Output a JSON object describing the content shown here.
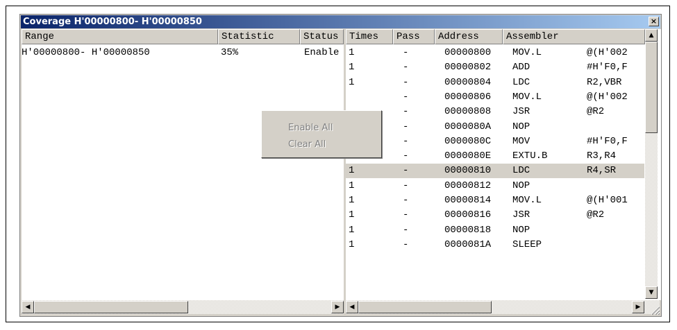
{
  "window": {
    "title": "Coverage H'00000800- H'00000850",
    "close_glyph": "×"
  },
  "left_pane": {
    "columns": [
      "Range",
      "Statistic",
      "Status"
    ],
    "rows": [
      {
        "range": "H'00000800- H'00000850",
        "statistic": "35%",
        "status": "Enable"
      }
    ]
  },
  "right_pane": {
    "columns": [
      "Times",
      "Pass",
      "Address",
      "Assembler"
    ],
    "rows": [
      {
        "times": "1",
        "pass": "-",
        "address": "00000800",
        "mnemonic": "MOV.L",
        "operand": "@(H'002"
      },
      {
        "times": "1",
        "pass": "-",
        "address": "00000802",
        "mnemonic": "ADD",
        "operand": "#H'F0,F"
      },
      {
        "times": "1",
        "pass": "-",
        "address": "00000804",
        "mnemonic": "LDC",
        "operand": "R2,VBR"
      },
      {
        "times": "",
        "pass": "-",
        "address": "00000806",
        "mnemonic": "MOV.L",
        "operand": "@(H'002"
      },
      {
        "times": "",
        "pass": "-",
        "address": "00000808",
        "mnemonic": "JSR",
        "operand": "@R2"
      },
      {
        "times": "",
        "pass": "-",
        "address": "0000080A",
        "mnemonic": "NOP",
        "operand": ""
      },
      {
        "times": "1",
        "pass": "-",
        "address": "0000080C",
        "mnemonic": "MOV",
        "operand": "#H'F0,F"
      },
      {
        "times": "1",
        "pass": "-",
        "address": "0000080E",
        "mnemonic": "EXTU.B",
        "operand": "R3,R4"
      },
      {
        "times": "1",
        "pass": "-",
        "address": "00000810",
        "mnemonic": "LDC",
        "operand": "R4,SR",
        "selected": true
      },
      {
        "times": "1",
        "pass": "-",
        "address": "00000812",
        "mnemonic": "NOP",
        "operand": ""
      },
      {
        "times": "1",
        "pass": "-",
        "address": "00000814",
        "mnemonic": "MOV.L",
        "operand": "@(H'001"
      },
      {
        "times": "1",
        "pass": "-",
        "address": "00000816",
        "mnemonic": "JSR",
        "operand": "@R2"
      },
      {
        "times": "1",
        "pass": "-",
        "address": "00000818",
        "mnemonic": "NOP",
        "operand": ""
      },
      {
        "times": "1",
        "pass": "-",
        "address": "0000081A",
        "mnemonic": "SLEEP",
        "operand": ""
      }
    ]
  },
  "context_menu": {
    "items": [
      {
        "label": "Enable All",
        "enabled": false
      },
      {
        "label": "Clear All",
        "enabled": false
      }
    ]
  },
  "scroll_glyphs": {
    "up": "▲",
    "down": "▼",
    "left": "◀",
    "right": "▶"
  },
  "colors": {
    "title_start": "#0a246a",
    "title_end": "#a6caf0",
    "face": "#d4d0c8",
    "disabled_text": "#808080"
  }
}
